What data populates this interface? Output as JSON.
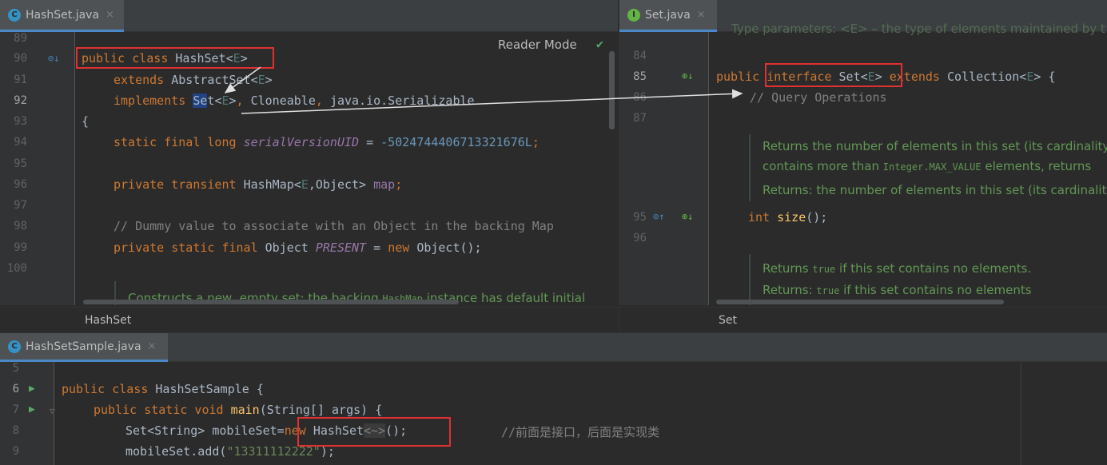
{
  "left_editor": {
    "tab": {
      "label": "HashSet.java",
      "icon": "class-icon",
      "close": "×"
    },
    "reader_mode": "Reader Mode",
    "breadcrumb": "HashSet",
    "line_numbers": [
      "89",
      "90",
      "91",
      "92",
      "93",
      "94",
      "95",
      "96",
      "97",
      "98",
      "99",
      "100"
    ],
    "code": {
      "l90_kw": "public class ",
      "l90_name": "HashSet",
      "l90_lt": "<",
      "l90_e": "E",
      "l90_gt": ">",
      "l91_kw": "extends ",
      "l91_name": "AbstractSet",
      "l91_lt": "<",
      "l91_e": "E",
      "l91_gt": ">",
      "l92_kw": "implements ",
      "l92_se": "Se",
      "l92_t": "t",
      "l92_lt": "<",
      "l92_e": "E",
      "l92_gt": ">",
      "l92_c1": ", ",
      "l92_clone": "Cloneable",
      "l92_c2": ", ",
      "l92_ser": "java.io.Serializable",
      "l93": "{",
      "l94_kw": "static final long ",
      "l94_field": "serialVersionUID",
      "l94_eq": " = ",
      "l94_num": "-5024744406713321676L",
      "l94_semi": ";",
      "l96_kw": "private transient ",
      "l96_type": "HashMap<",
      "l96_e": "E",
      "l96_rest": ",Object> ",
      "l96_field": "map",
      "l96_semi": ";",
      "l98_cmt": "// Dummy value to associate with an Object in the backing Map",
      "l99_kw": "private static final ",
      "l99_type": "Object ",
      "l99_field": "PRESENT",
      "l99_eq": " = ",
      "l99_new": "new ",
      "l99_rest": "Object();",
      "doc_a": "Constructs a new, empty set; the backing ",
      "doc_code": "HashMap",
      "doc_b": " instance has default initial"
    }
  },
  "right_editor": {
    "tab": {
      "label": "Set.java",
      "icon": "interface-icon",
      "close": "×"
    },
    "breadcrumb": "Set",
    "line_numbers": [
      "84",
      "85",
      "86",
      "87",
      "95",
      "96"
    ],
    "code": {
      "top_doc": "Type parameters: <E> – the type of elements maintained by t",
      "l85_pub": "public ",
      "l85_kw": "interface ",
      "l85_name": "Set",
      "l85_lt": "<",
      "l85_e": "E",
      "l85_gt": ">",
      "l85_ext": " extends ",
      "l85_coll": "Collection<",
      "l85_e2": "E",
      "l85_rest": "> {",
      "l86": "// Query Operations",
      "doc1_l1": "Returns the number of elements in this set (its cardinality",
      "doc1_l2a": "contains more than ",
      "doc1_l2code": "Integer.MAX_VALUE",
      "doc1_l2b": " elements, returns",
      "doc1_l3": "Returns: the number of elements in this set (its cardinalit",
      "l95_kw": "int ",
      "l95_fn": "size",
      "l95_rest": "();",
      "doc2_l1a": "Returns ",
      "doc2_l1code": "true",
      "doc2_l1b": " if this set contains no elements.",
      "doc2_l2a": "Returns: ",
      "doc2_l2code": "true",
      "doc2_l2b": " if this set contains no elements"
    }
  },
  "bottom_editor": {
    "tab": {
      "label": "HashSetSample.java",
      "icon": "class-icon",
      "close": "×"
    },
    "line_numbers": [
      "5",
      "6",
      "7",
      "8",
      "9"
    ],
    "code": {
      "l6_kw": "public class ",
      "l6_name": "HashSetSample {",
      "l7_kw": "public static void ",
      "l7_fn": "main",
      "l7_rest": "(String[] args) {",
      "l8_a": "Set<String> mobileSet=",
      "l8_new": "new ",
      "l8_type": "HashSet",
      "l8_diamond": "<~>",
      "l8_rest": "();",
      "l8_cmt": "//前面是接口，后面是实现类",
      "l9_a": "mobileSet.add(",
      "l9_str": "\"13311112222\"",
      "l9_b": ");"
    }
  },
  "colors": {
    "annotation_red": "#e03131",
    "doc_green": "#629755",
    "keyword": "#cc7832"
  }
}
